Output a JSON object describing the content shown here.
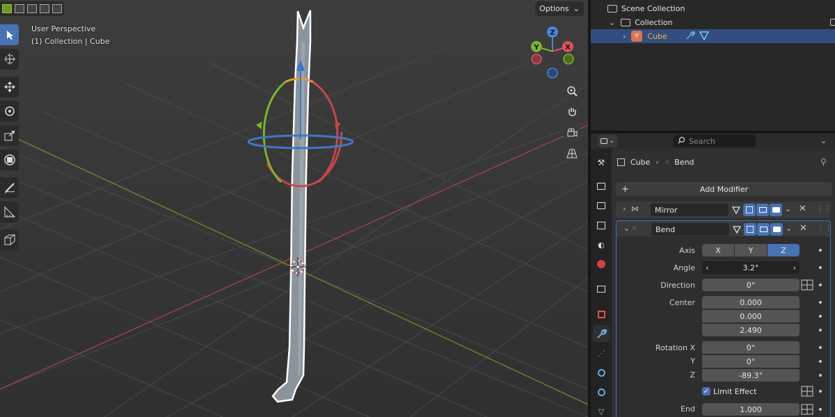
{
  "viewport": {
    "view_name": "User Perspective",
    "context": "(1) Collection | Cube",
    "options_label": "Options",
    "colors": {
      "x_axis": "#e05060",
      "y_axis": "#7db32e",
      "z_axis": "#4a86d8",
      "outline": "#ffffff"
    },
    "gizmo": {
      "x": "X",
      "y": "Y",
      "z": "Z"
    },
    "tools": [
      "select-box",
      "cursor",
      "move",
      "rotate",
      "scale",
      "transform",
      "annotate",
      "measure",
      "add-cube"
    ],
    "nav": [
      "zoom",
      "pan",
      "camera",
      "perspective-toggle"
    ]
  },
  "outliner": {
    "scene_collection": "Scene Collection",
    "collection": "Collection",
    "object": "Cube"
  },
  "properties": {
    "search_placeholder": "Search",
    "breadcrumb": {
      "object": "Cube",
      "modifier": "Bend"
    },
    "add_modifier": "Add Modifier",
    "mirror": {
      "name": "Mirror"
    },
    "bend": {
      "name": "Bend",
      "axis_label": "Axis",
      "axis_options": [
        "X",
        "Y",
        "Z"
      ],
      "axis_selected": "Z",
      "angle_label": "Angle",
      "angle": "3.2°",
      "direction_label": "Direction",
      "direction": "0°",
      "center_label": "Center",
      "center": [
        "0.000",
        "0.000",
        "2.490"
      ],
      "rotation_label": "Rotation X",
      "rotation_y_label": "Y",
      "rotation_z_label": "Z",
      "rotation": [
        "0°",
        "0°",
        "-89.3°"
      ],
      "limit_effect": "Limit Effect",
      "end_label": "End",
      "end": "1.000"
    }
  }
}
